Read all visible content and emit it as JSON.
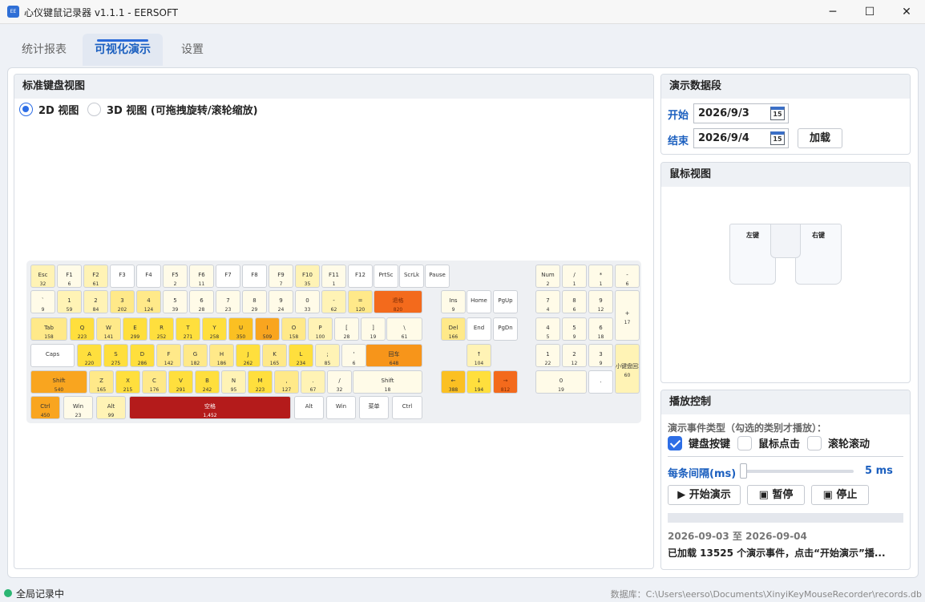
{
  "window": {
    "app_icon_text": "EE",
    "title": "心仪键鼠记录器 v1.1.1 - EERSOFT",
    "min_glyph": "─",
    "max_glyph": "☐",
    "close_glyph": "✕"
  },
  "tabs": [
    "统计报表",
    "可视化演示",
    "设置"
  ],
  "active_tab": 1,
  "keyboard_panel": {
    "title": "标准键盘视图",
    "radio_2d": "2D 视图",
    "radio_3d": "3D 视图 (可拖拽旋转/滚轮缩放)",
    "selected": "2D 视图"
  },
  "keys": [
    {
      "id": "esc",
      "label": "Esc",
      "count": "32",
      "heat": 2
    },
    {
      "id": "f1",
      "label": "F1",
      "count": "6",
      "heat": 1
    },
    {
      "id": "f2",
      "label": "F2",
      "count": "61",
      "heat": 2
    },
    {
      "id": "f3",
      "label": "F3",
      "count": "",
      "heat": 0
    },
    {
      "id": "f4",
      "label": "F4",
      "count": "",
      "heat": 0
    },
    {
      "id": "f5",
      "label": "F5",
      "count": "2",
      "heat": 1
    },
    {
      "id": "f6",
      "label": "F6",
      "count": "11",
      "heat": 1
    },
    {
      "id": "f7",
      "label": "F7",
      "count": "",
      "heat": 0
    },
    {
      "id": "f8",
      "label": "F8",
      "count": "",
      "heat": 0
    },
    {
      "id": "f9",
      "label": "F9",
      "count": "7",
      "heat": 1
    },
    {
      "id": "f10",
      "label": "F10",
      "count": "35",
      "heat": 2
    },
    {
      "id": "f11",
      "label": "F11",
      "count": "1",
      "heat": 1
    },
    {
      "id": "f12",
      "label": "F12",
      "count": "",
      "heat": 0
    },
    {
      "id": "prtsc",
      "label": "PrtSc",
      "count": "",
      "heat": 0
    },
    {
      "id": "scrlk",
      "label": "ScrLk",
      "count": "",
      "heat": 0
    },
    {
      "id": "pause",
      "label": "Pause",
      "count": "",
      "heat": 0
    },
    {
      "id": "grave",
      "label": "`",
      "count": "9",
      "heat": 1
    },
    {
      "id": "d1",
      "label": "1",
      "count": "59",
      "heat": 2
    },
    {
      "id": "d2",
      "label": "2",
      "count": "84",
      "heat": 2
    },
    {
      "id": "d3",
      "label": "3",
      "count": "202",
      "heat": 3
    },
    {
      "id": "d4",
      "label": "4",
      "count": "124",
      "heat": 3
    },
    {
      "id": "d5",
      "label": "5",
      "count": "39",
      "heat": 1
    },
    {
      "id": "d6",
      "label": "6",
      "count": "28",
      "heat": 1
    },
    {
      "id": "d7",
      "label": "7",
      "count": "23",
      "heat": 1
    },
    {
      "id": "d8",
      "label": "8",
      "count": "29",
      "heat": 1
    },
    {
      "id": "d9",
      "label": "9",
      "count": "24",
      "heat": 1
    },
    {
      "id": "d0",
      "label": "0",
      "count": "33",
      "heat": 1
    },
    {
      "id": "minus",
      "label": "-",
      "count": "62",
      "heat": 2
    },
    {
      "id": "equal",
      "label": "=",
      "count": "120",
      "heat": 3
    },
    {
      "id": "bksp",
      "label": "退格",
      "count": "820",
      "heat": 8
    },
    {
      "id": "tab",
      "label": "Tab",
      "count": "158",
      "heat": 3
    },
    {
      "id": "q",
      "label": "Q",
      "count": "223",
      "heat": 4
    },
    {
      "id": "w",
      "label": "W",
      "count": "141",
      "heat": 3
    },
    {
      "id": "e",
      "label": "E",
      "count": "299",
      "heat": 4
    },
    {
      "id": "r",
      "label": "R",
      "count": "252",
      "heat": 4
    },
    {
      "id": "t",
      "label": "T",
      "count": "271",
      "heat": 4
    },
    {
      "id": "y",
      "label": "Y",
      "count": "258",
      "heat": 4
    },
    {
      "id": "u",
      "label": "U",
      "count": "350",
      "heat": 5
    },
    {
      "id": "i",
      "label": "I",
      "count": "509",
      "heat": 6
    },
    {
      "id": "o",
      "label": "O",
      "count": "158",
      "heat": 3
    },
    {
      "id": "p",
      "label": "P",
      "count": "100",
      "heat": 2
    },
    {
      "id": "lbr",
      "label": "[",
      "count": "28",
      "heat": 1
    },
    {
      "id": "rbr",
      "label": "]",
      "count": "19",
      "heat": 1
    },
    {
      "id": "bsl",
      "label": "\\",
      "count": "61",
      "heat": 1
    },
    {
      "id": "caps",
      "label": "Caps",
      "count": "",
      "heat": 0
    },
    {
      "id": "a",
      "label": "A",
      "count": "220",
      "heat": 4
    },
    {
      "id": "s",
      "label": "S",
      "count": "275",
      "heat": 4
    },
    {
      "id": "d",
      "label": "D",
      "count": "286",
      "heat": 4
    },
    {
      "id": "f",
      "label": "F",
      "count": "142",
      "heat": 3
    },
    {
      "id": "g",
      "label": "G",
      "count": "182",
      "heat": 3
    },
    {
      "id": "h",
      "label": "H",
      "count": "186",
      "heat": 3
    },
    {
      "id": "j",
      "label": "J",
      "count": "262",
      "heat": 4
    },
    {
      "id": "k",
      "label": "K",
      "count": "165",
      "heat": 3
    },
    {
      "id": "l",
      "label": "L",
      "count": "234",
      "heat": 4
    },
    {
      "id": "semi",
      "label": ";",
      "count": "85",
      "heat": 2
    },
    {
      "id": "quote",
      "label": "'",
      "count": "6",
      "heat": 1
    },
    {
      "id": "enter",
      "label": "回车",
      "count": "648",
      "heat": 7
    },
    {
      "id": "lshift",
      "label": "Shift",
      "count": "540",
      "heat": 6
    },
    {
      "id": "z",
      "label": "Z",
      "count": "165",
      "heat": 3
    },
    {
      "id": "x",
      "label": "X",
      "count": "215",
      "heat": 4
    },
    {
      "id": "c",
      "label": "C",
      "count": "176",
      "heat": 3
    },
    {
      "id": "v",
      "label": "V",
      "count": "291",
      "heat": 4
    },
    {
      "id": "b",
      "label": "B",
      "count": "242",
      "heat": 4
    },
    {
      "id": "n",
      "label": "N",
      "count": "95",
      "heat": 2
    },
    {
      "id": "m",
      "label": "M",
      "count": "223",
      "heat": 4
    },
    {
      "id": "comma",
      "label": ",",
      "count": "127",
      "heat": 3
    },
    {
      "id": "period",
      "label": ".",
      "count": "67",
      "heat": 2
    },
    {
      "id": "slash",
      "label": "/",
      "count": "32",
      "heat": 1
    },
    {
      "id": "rshift",
      "label": "Shift",
      "count": "18",
      "heat": 1
    },
    {
      "id": "lctrl",
      "label": "Ctrl",
      "count": "450",
      "heat": 6
    },
    {
      "id": "lwin",
      "label": "Win",
      "count": "23",
      "heat": 1
    },
    {
      "id": "lalt",
      "label": "Alt",
      "count": "99",
      "heat": 2
    },
    {
      "id": "space",
      "label": "空格",
      "count": "1,452",
      "heat": 9
    },
    {
      "id": "ralt",
      "label": "Alt",
      "count": "",
      "heat": 0
    },
    {
      "id": "rwin",
      "label": "Win",
      "count": "",
      "heat": 0
    },
    {
      "id": "menu",
      "label": "菜单",
      "count": "",
      "heat": 0
    },
    {
      "id": "rctrl",
      "label": "Ctrl",
      "count": "",
      "heat": 0
    },
    {
      "id": "ins",
      "label": "Ins",
      "count": "9",
      "heat": 1
    },
    {
      "id": "home",
      "label": "Home",
      "count": "",
      "heat": 0
    },
    {
      "id": "pgup",
      "label": "PgUp",
      "count": "",
      "heat": 0
    },
    {
      "id": "del",
      "label": "Del",
      "count": "166",
      "heat": 3
    },
    {
      "id": "end",
      "label": "End",
      "count": "",
      "heat": 0
    },
    {
      "id": "pgdn",
      "label": "PgDn",
      "count": "",
      "heat": 0
    },
    {
      "id": "up",
      "label": "↑",
      "count": "104",
      "heat": 2
    },
    {
      "id": "left",
      "label": "←",
      "count": "388",
      "heat": 5
    },
    {
      "id": "down",
      "label": "↓",
      "count": "194",
      "heat": 4
    },
    {
      "id": "right",
      "label": "→",
      "count": "812",
      "heat": 8
    },
    {
      "id": "numlock",
      "label": "Num",
      "count": "2",
      "heat": 1
    },
    {
      "id": "kpdiv",
      "label": "/",
      "count": "1",
      "heat": 1
    },
    {
      "id": "kpmul",
      "label": "*",
      "count": "1",
      "heat": 1
    },
    {
      "id": "kpsub",
      "label": "-",
      "count": "6",
      "heat": 1
    },
    {
      "id": "kp7",
      "label": "7",
      "count": "4",
      "heat": 1
    },
    {
      "id": "kp8",
      "label": "8",
      "count": "6",
      "heat": 1
    },
    {
      "id": "kp9",
      "label": "9",
      "count": "12",
      "heat": 1
    },
    {
      "id": "kpadd",
      "label": "+",
      "count": "17",
      "heat": 1
    },
    {
      "id": "kp4",
      "label": "4",
      "count": "5",
      "heat": 1
    },
    {
      "id": "kp5",
      "label": "5",
      "count": "9",
      "heat": 1
    },
    {
      "id": "kp6",
      "label": "6",
      "count": "18",
      "heat": 1
    },
    {
      "id": "kp1",
      "label": "1",
      "count": "22",
      "heat": 1
    },
    {
      "id": "kp2",
      "label": "2",
      "count": "12",
      "heat": 1
    },
    {
      "id": "kp3",
      "label": "3",
      "count": "9",
      "heat": 1
    },
    {
      "id": "kpenter",
      "label": "小键盘回车",
      "count": "60",
      "heat": 2
    },
    {
      "id": "kp0",
      "label": "0",
      "count": "19",
      "heat": 1
    },
    {
      "id": "kpdot",
      "label": ".",
      "count": "",
      "heat": 0
    }
  ],
  "heat_colors": [
    "#ffffff",
    "#fffbe8",
    "#fff3b5",
    "#ffe989",
    "#ffdf3d",
    "#fbc022",
    "#f9a51f",
    "#f7951a",
    "#f36a1c",
    "#b41b1b"
  ],
  "date_panel": {
    "title": "演示数据段",
    "start_label": "开始",
    "start_value": "2026/9/3",
    "end_label": "结束",
    "end_value": "2026/9/4",
    "calendar_glyph": "15",
    "load_button": "加载"
  },
  "mouse_panel": {
    "title": "鼠标视图",
    "left_label": "左键",
    "right_label": "右键"
  },
  "play_panel": {
    "title": "播放控制",
    "event_types_label": "演示事件类型（勾选的类别才播放）：",
    "check_keyboard": "键盘按键",
    "check_keyboard_checked": true,
    "check_mouse_click": "鼠标点击",
    "check_mouse_click_checked": false,
    "check_scroll": "滚轮滚动",
    "check_scroll_checked": false,
    "interval_label": "每条间隔(ms)",
    "interval_value": "5 ms",
    "start_button": "开始演示",
    "pause_button": "暂停",
    "stop_button": "停止",
    "progress": 0,
    "range_text": "2026-09-03 至 2026-09-04",
    "status_text": "已加载 13525 个演示事件，点击“开始演示”播..."
  },
  "statusbar": {
    "recording_text": "全局记录中",
    "recording_color": "#2bb673",
    "db_label": "数据库：",
    "db_path": "C:\\Users\\eerso\\Documents\\XinyiKeyMouseRecorder\\records.db"
  }
}
